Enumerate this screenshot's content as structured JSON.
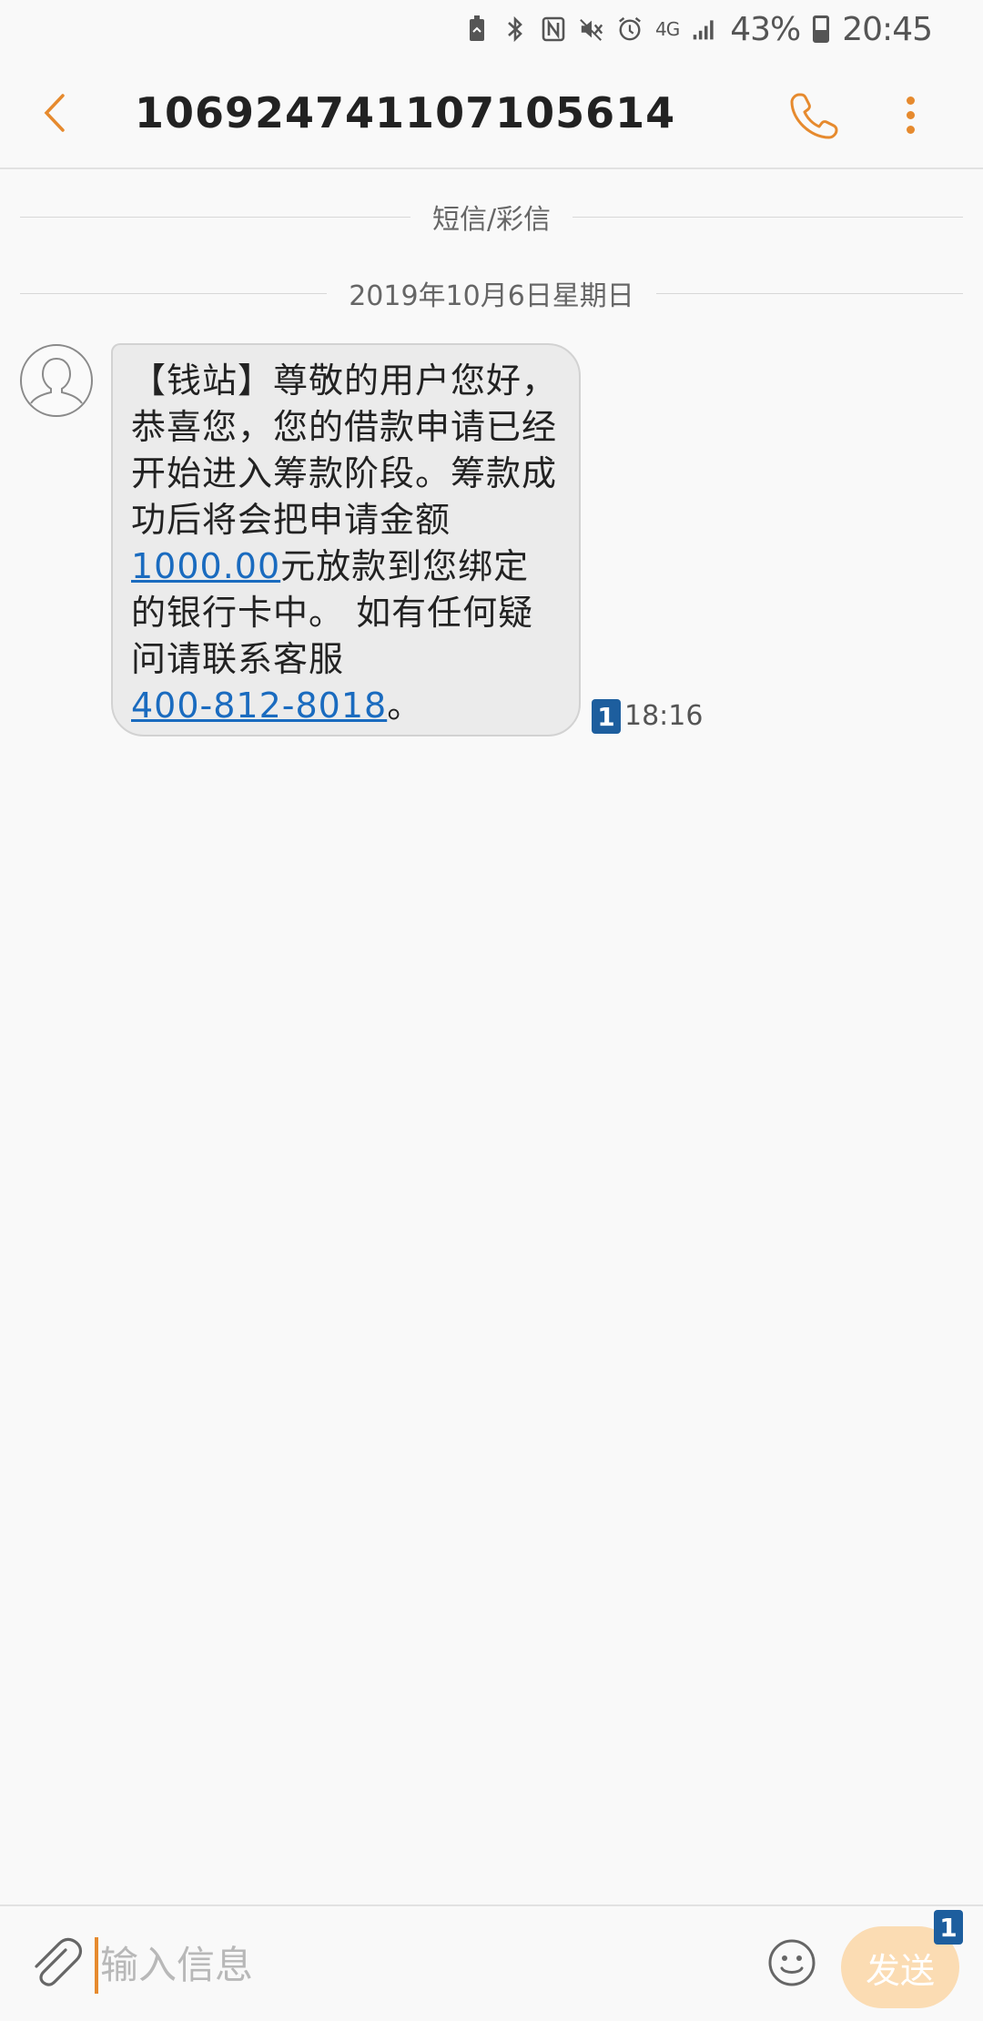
{
  "status_bar": {
    "network": "4G",
    "battery_text": "43%",
    "time": "20:45",
    "icons": [
      "battery-saver-icon",
      "bluetooth-icon",
      "nfc-icon",
      "mute-icon",
      "alarm-icon",
      "signal-icon"
    ]
  },
  "header": {
    "title": "106924741107105614",
    "icons": [
      "back-icon",
      "phone-icon",
      "more-icon"
    ],
    "accent_color": "#e68a2e"
  },
  "conversation": {
    "channel_label": "短信/彩信",
    "date_label": "2019年10月6日星期日",
    "messages": [
      {
        "text_before": "【钱站】尊敬的用户您好，恭喜您，您的借款申请已经开始进入筹款阶段。筹款成功后将会把申请金额",
        "amount": "1000.00",
        "text_middle": "元放款到您绑定的银行卡中。 如有任何疑问请联系客服",
        "phone": "400-812-8018",
        "text_after": "。",
        "sim": "1",
        "time": "18:16"
      }
    ]
  },
  "composer": {
    "placeholder": "输入信息",
    "send_label": "发送",
    "sim_badge": "1",
    "icons": [
      "attach-icon",
      "emoji-icon"
    ],
    "link_color": "#1a6bbf"
  }
}
